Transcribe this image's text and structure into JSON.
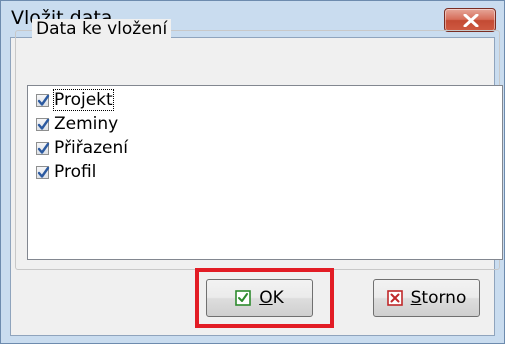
{
  "window": {
    "title": "Vložit data",
    "close_icon": "close-icon"
  },
  "group": {
    "legend": "Data ke vložení"
  },
  "list": {
    "items": [
      {
        "label": "Projekt",
        "checked": true,
        "focused": true
      },
      {
        "label": "Zeminy",
        "checked": true,
        "focused": false
      },
      {
        "label": "Přiřazení",
        "checked": true,
        "focused": false
      },
      {
        "label": "Profil",
        "checked": true,
        "focused": false
      }
    ]
  },
  "buttons": {
    "ok": {
      "label": "OK",
      "mnemonic": "O",
      "icon": "check-icon"
    },
    "storno": {
      "label": "Storno",
      "mnemonic": "S",
      "icon": "cross-icon"
    }
  },
  "colors": {
    "frame": "#c9dcef",
    "highlight": "#e21c25",
    "check": "#2c5aa0",
    "ok_icon": "#2e8b2e",
    "storno_icon": "#c0282a"
  }
}
